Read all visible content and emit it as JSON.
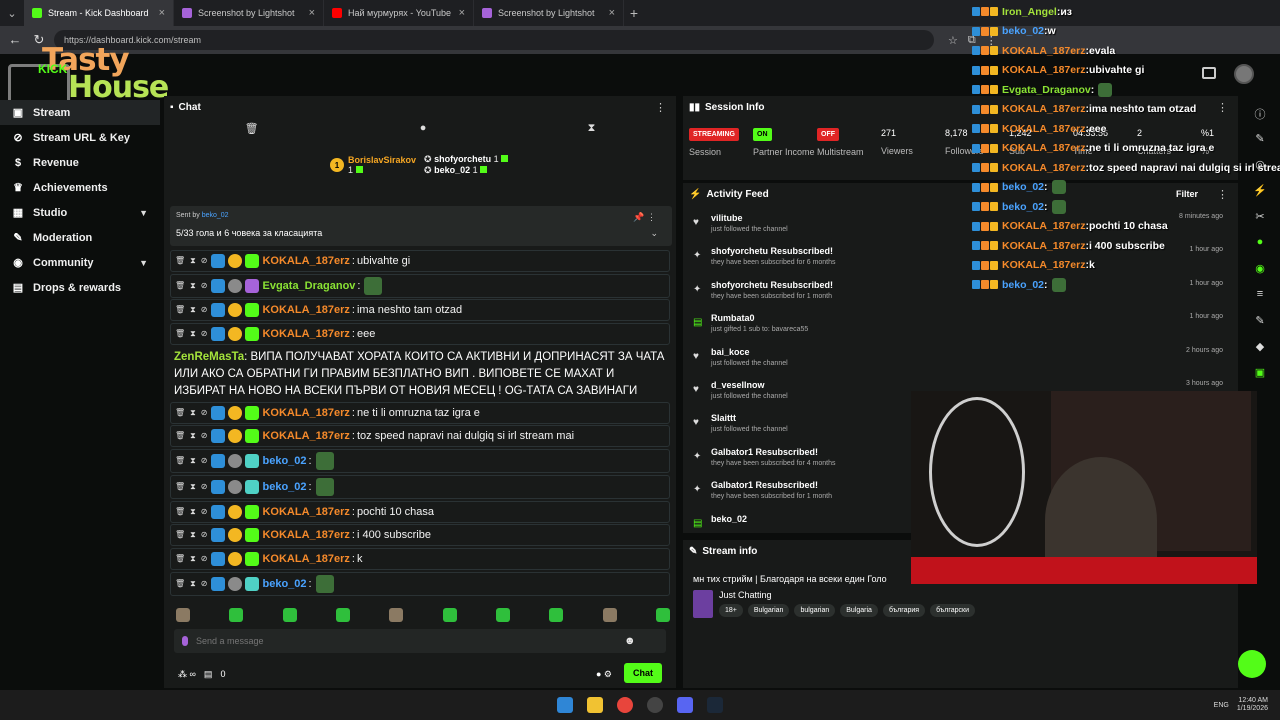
{
  "browser": {
    "tabs": [
      {
        "label": "Stream - Kick Dashboard",
        "color": "#53fc18",
        "active": true
      },
      {
        "label": "Screenshot by Lightshot",
        "color": "#a663d9",
        "active": false
      },
      {
        "label": "Най мурмурях - YouTube",
        "color": "#ff0000",
        "active": false
      },
      {
        "label": "Screenshot by Lightshot",
        "color": "#a663d9",
        "active": false
      }
    ],
    "url": "https://dashboard.kick.com/stream"
  },
  "logo": {
    "line1": "Tasty",
    "line2": "House",
    "kick": "KICK"
  },
  "sidebar": {
    "items": [
      {
        "label": "Stream",
        "icon": "video-icon"
      },
      {
        "label": "Stream URL & Key",
        "icon": "link-icon"
      },
      {
        "label": "Revenue",
        "icon": "dollar-icon"
      },
      {
        "label": "Achievements",
        "icon": "trophy-icon"
      },
      {
        "label": "Studio",
        "icon": "studio-icon"
      },
      {
        "label": "Moderation",
        "icon": "wrench-icon"
      },
      {
        "label": "Community",
        "icon": "globe-icon"
      },
      {
        "label": "Drops & rewards",
        "icon": "gift-icon"
      }
    ]
  },
  "chat": {
    "title": "Chat",
    "leaderboard": [
      {
        "name": "BorislavSirakov",
        "count": "1"
      },
      {
        "name": "shofyorchetu",
        "count": "1"
      },
      {
        "name": "beko_02",
        "count": "1"
      }
    ],
    "pinned": {
      "by_label": "Sent by",
      "by_user": "beko_02",
      "message": "5/33 гола и 6 човека за класацията"
    },
    "messages": [
      {
        "user": "KOKALA_187erz",
        "text": "ubivahte gi",
        "ucls": "u-orange",
        "badges": [
          "blue",
          "gold",
          "green"
        ],
        "emote": false
      },
      {
        "user": "Evgata_Draganov",
        "text": "",
        "ucls": "u-green",
        "badges": [
          "blue",
          "grey",
          "pink"
        ],
        "emote": true
      },
      {
        "user": "KOKALA_187erz",
        "text": "ima neshto tam otzad",
        "ucls": "u-orange",
        "badges": [
          "blue",
          "gold",
          "green"
        ],
        "emote": false
      },
      {
        "user": "KOKALA_187erz",
        "text": "eee",
        "ucls": "u-orange",
        "badges": [
          "blue",
          "gold",
          "green"
        ],
        "emote": false
      }
    ],
    "big_message": {
      "user": "ZenReMasTa",
      "text": "ВИПА ПОЛУЧАВАТ ХОРАТА КОИТО СА АКТИВНИ И ДОПРИНАСЯТ ЗА ЧАТА ИЛИ АКО СА ОБРАТНИ ГИ ПРАВИМ БЕЗПЛАТНО ВИП . ВИПОВЕТЕ СЕ МАХАТ И ИЗБИРАТ НА НОВО НА ВСЕКИ ПЪРВИ ОТ НОВИЯ МЕСЕЦ ! OG-ТАТА СА ЗАВИНАГИ"
    },
    "messages2": [
      {
        "user": "KOKALA_187erz",
        "text": "ne ti li omruzna taz igra e",
        "ucls": "u-orange",
        "badges": [
          "blue",
          "gold",
          "green"
        ],
        "emote": false
      },
      {
        "user": "KOKALA_187erz",
        "text": "toz speed napravi nai dulgiq si irl stream mai",
        "ucls": "u-orange",
        "badges": [
          "blue",
          "gold",
          "green"
        ],
        "emote": false
      },
      {
        "user": "beko_02",
        "text": "",
        "ucls": "u-blue",
        "badges": [
          "blue",
          "grey",
          "teal"
        ],
        "emote": true
      },
      {
        "user": "beko_02",
        "text": "",
        "ucls": "u-blue",
        "badges": [
          "blue",
          "grey",
          "teal"
        ],
        "emote": true
      },
      {
        "user": "KOKALA_187erz",
        "text": "pochti 10 chasa",
        "ucls": "u-orange",
        "badges": [
          "blue",
          "gold",
          "green"
        ],
        "emote": false
      },
      {
        "user": "KOKALA_187erz",
        "text": "i 400 subscribe",
        "ucls": "u-orange",
        "badges": [
          "blue",
          "gold",
          "green"
        ],
        "emote": false
      },
      {
        "user": "KOKALA_187erz",
        "text": "k",
        "ucls": "u-orange",
        "badges": [
          "blue",
          "gold",
          "green"
        ],
        "emote": false
      },
      {
        "user": "beko_02",
        "text": "",
        "ucls": "u-blue",
        "badges": [
          "blue",
          "grey",
          "teal"
        ],
        "emote": true
      }
    ],
    "input_placeholder": "Send a message",
    "footer_count": "0",
    "chat_button": "Chat"
  },
  "session": {
    "title": "Session Info",
    "stats": [
      {
        "pill": "STREAMING",
        "pill_color": "red",
        "label": "Session"
      },
      {
        "pill": "ON",
        "pill_color": "green",
        "label": "Partner Income"
      },
      {
        "pill": "OFF",
        "pill_color": "red",
        "label": "Multistream"
      },
      {
        "value": "271",
        "label": "Viewers"
      },
      {
        "value": "8,178",
        "label": "Followers"
      },
      {
        "value": "1,242",
        "label": "Sub"
      },
      {
        "value": "04:33:56",
        "label": "Time"
      },
      {
        "value": "2",
        "label": "Chatters"
      },
      {
        "value": "%1",
        "label": "%"
      }
    ]
  },
  "activity": {
    "title": "Activity Feed",
    "filter": "Filter",
    "items": [
      {
        "icon": "heart",
        "name": "vilitube",
        "desc": "just followed the channel",
        "time": "8 minutes ago"
      },
      {
        "icon": "star",
        "name": "shofyorchetu Resubscribed!",
        "desc": "they have been subscribed for 6 months",
        "time": "1 hour ago"
      },
      {
        "icon": "star",
        "name": "shofyorchetu Resubscribed!",
        "desc": "they have been subscribed for 1 month",
        "time": "1 hour ago"
      },
      {
        "icon": "gift",
        "name": "Rumbata0",
        "desc": "just gifted 1 sub to: bavareca55",
        "time": "1 hour ago"
      },
      {
        "icon": "heart",
        "name": "bai_koce",
        "desc": "just followed the channel",
        "time": "2 hours ago"
      },
      {
        "icon": "heart",
        "name": "d_vesellnow",
        "desc": "just followed the channel",
        "time": "3 hours ago"
      },
      {
        "icon": "heart",
        "name": "Slaittt",
        "desc": "just followed the channel",
        "time": ""
      },
      {
        "icon": "star",
        "name": "Galbator1 Resubscribed!",
        "desc": "they have been subscribed for 4 months",
        "time": ""
      },
      {
        "icon": "star",
        "name": "Galbator1 Resubscribed!",
        "desc": "they have been subscribed for 1 month",
        "time": ""
      },
      {
        "icon": "gift",
        "name": "beko_02",
        "desc": "",
        "time": ""
      }
    ]
  },
  "stream_info": {
    "title": "Stream info",
    "stream_title": "мн тих стрийм  |  Благодаря на всеки един Голо",
    "category": "Just Chatting",
    "tags": [
      "18+",
      "Bulgarian",
      "bulgarian",
      "Bulgaria",
      "българия",
      "български"
    ]
  },
  "overlay_chat": [
    {
      "user": "Iron_Angel",
      "text": "из",
      "color": "#a4e33b"
    },
    {
      "user": "beko_02",
      "text": "w",
      "color": "#4aa3ff"
    },
    {
      "user": "KOKALA_187erz",
      "text": "evala",
      "color": "#f58a2b"
    },
    {
      "user": "KOKALA_187erz",
      "text": "ubivahte gi",
      "color": "#f58a2b"
    },
    {
      "user": "Evgata_Draganov",
      "text": "",
      "color": "#8ae234"
    },
    {
      "user": "KOKALA_187erz",
      "text": "ima neshto tam otzad",
      "color": "#f58a2b"
    },
    {
      "user": "KOKALA_187erz",
      "text": "eee",
      "color": "#f58a2b"
    },
    {
      "user": "KOKALA_187erz",
      "text": "ne ti li omruzna taz igra e",
      "color": "#f58a2b"
    },
    {
      "user": "KOKALA_187erz",
      "text": "toz speed napravi nai dulgiq si irl strea",
      "color": "#f58a2b"
    },
    {
      "user": "beko_02",
      "text": "",
      "color": "#4aa3ff"
    },
    {
      "user": "beko_02",
      "text": "",
      "color": "#4aa3ff"
    },
    {
      "user": "KOKALA_187erz",
      "text": "pochti 10 chasa",
      "color": "#f58a2b"
    },
    {
      "user": "KOKALA_187erz",
      "text": "i 400 subscribe",
      "color": "#f58a2b"
    },
    {
      "user": "KOKALA_187erz",
      "text": "k",
      "color": "#f58a2b"
    },
    {
      "user": "beko_02",
      "text": "",
      "color": "#4aa3ff"
    }
  ],
  "taskbar": {
    "lang": "ENG",
    "time": "12:40 AM",
    "date": "1/19/2026"
  }
}
